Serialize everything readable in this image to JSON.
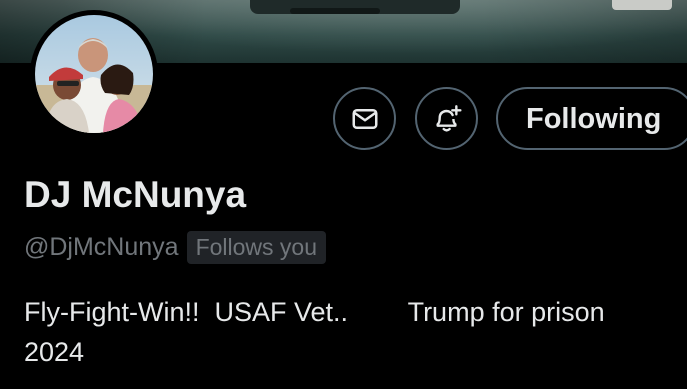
{
  "profile": {
    "display_name": "DJ McNunya",
    "handle": "@DjMcNunya",
    "follows_badge": "Follows you",
    "bio": "Fly-Fight-Win!!  USAF Vet..        Trump for prison\n2024"
  },
  "actions": {
    "message_icon": "envelope-icon",
    "notify_icon": "bell-plus-icon",
    "following_label": "Following"
  },
  "colors": {
    "background": "#000000",
    "text_primary": "#e7e9ea",
    "text_secondary": "#71767b",
    "border": "#536471"
  }
}
